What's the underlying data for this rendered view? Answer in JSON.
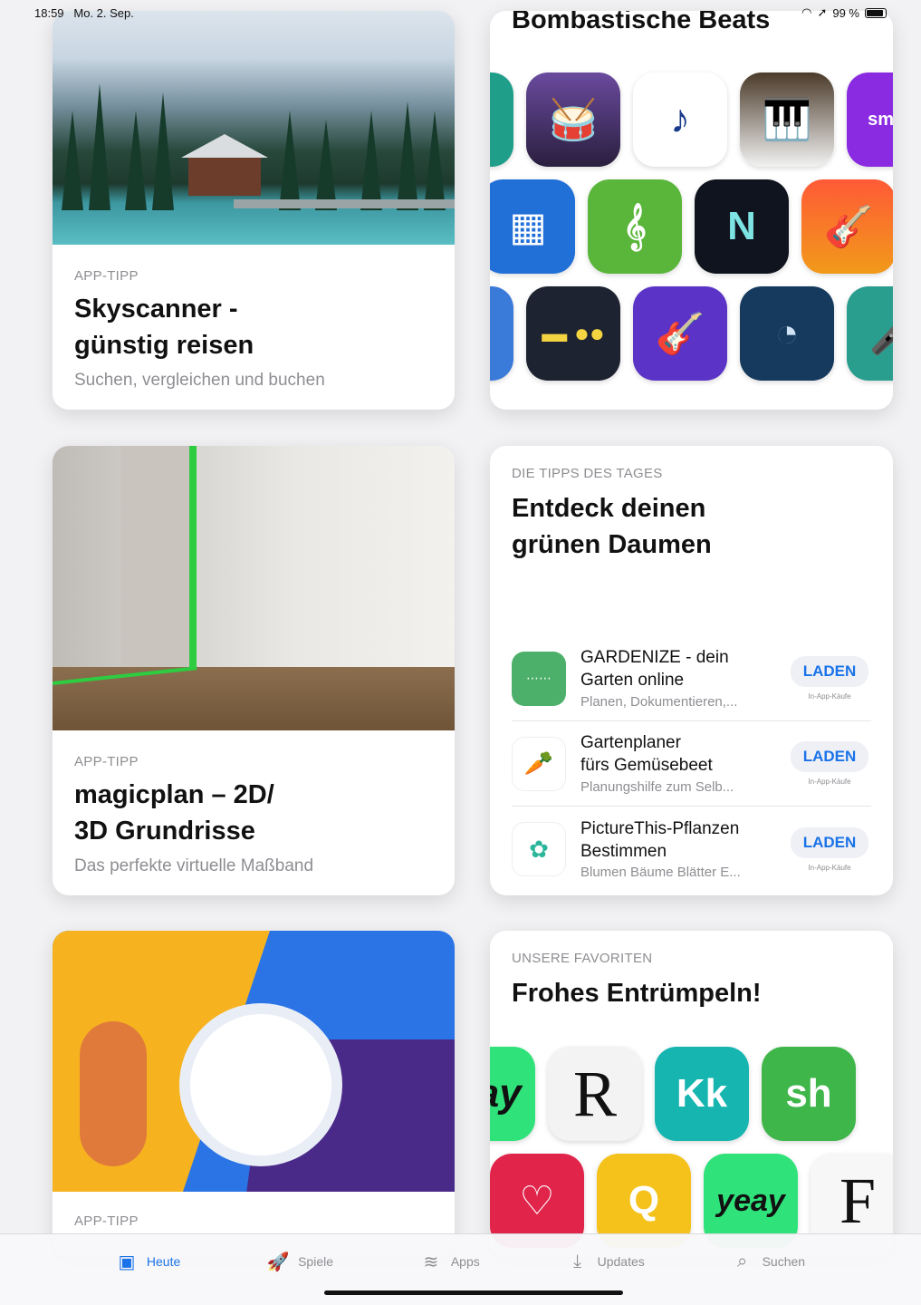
{
  "status": {
    "time": "18:59",
    "date": "Mo. 2. Sep.",
    "battery": "99 %"
  },
  "cards": {
    "skyscanner": {
      "eyebrow": "APP-TIPP",
      "title": "Skyscanner -\ngünstig reisen",
      "subtitle": "Suchen, vergleichen und buchen"
    },
    "beats": {
      "title": "Bombastische Beats"
    },
    "magicplan": {
      "eyebrow": "APP-TIPP",
      "title": "magicplan – 2D/\n3D Grundrisse",
      "subtitle": "Das perfekte virtuelle Maßband"
    },
    "tips": {
      "eyebrow": "DIE TIPPS DES TAGES",
      "title": "Entdeck deinen\ngrünen Daumen",
      "apps": [
        {
          "name": "GARDENIZE - dein\nGarten online",
          "desc": "Planen, Dokumentieren,...",
          "button": "LADEN",
          "iap": "In-App-Käufe",
          "icon": "gardenize-icon"
        },
        {
          "name": "Gartenplaner\nfürs Gemüsebeet",
          "desc": "Planungshilfe zum Selb...",
          "button": "LADEN",
          "iap": "In-App-Käufe",
          "icon": "carrot-icon"
        },
        {
          "name": "PictureThis-Pflanzen\nBestimmen",
          "desc": "Blumen Bäume Blätter E...",
          "button": "LADEN",
          "iap": "In-App-Käufe",
          "icon": "leaf-icon"
        }
      ]
    },
    "activity": {
      "eyebrow": "APP-TIPP"
    },
    "favoriten": {
      "eyebrow": "UNSERE FAVORITEN",
      "title": "Frohes Entrümpeln!"
    }
  },
  "beats_icons": [
    [
      "drum-icon",
      "music-note-icon",
      "piano-icon",
      "smule-icon"
    ],
    [
      "launchpad-icon",
      "treble-clef-icon",
      "n-icon",
      "garageband-icon"
    ],
    [
      "synth-icon",
      "guitarist-icon",
      "dial-icon",
      "band-icon"
    ]
  ],
  "fav_icons": [
    {
      "label": "eay",
      "icon": "yeay-icon"
    },
    {
      "label": "R",
      "icon": "r-icon"
    },
    {
      "label": "Kk",
      "icon": "kk-icon"
    },
    {
      "label": "sh",
      "icon": "sh-icon"
    }
  ],
  "fav_icons_row2": [
    {
      "label": "",
      "icon": "heart-icon"
    },
    {
      "label": "Q",
      "icon": "q-icon"
    },
    {
      "label": "yeay",
      "icon": "yeay-icon"
    },
    {
      "label": "F",
      "icon": "f-icon"
    }
  ],
  "tabbar": [
    {
      "label": "Heute",
      "icon": "today-icon",
      "active": true
    },
    {
      "label": "Spiele",
      "icon": "rocket-icon",
      "active": false
    },
    {
      "label": "Apps",
      "icon": "stack-icon",
      "active": false
    },
    {
      "label": "Updates",
      "icon": "download-icon",
      "active": false
    },
    {
      "label": "Suchen",
      "icon": "search-icon",
      "active": false
    }
  ],
  "colors": {
    "accent": "#1a73e8",
    "secondary_text": "#8e8e93"
  }
}
